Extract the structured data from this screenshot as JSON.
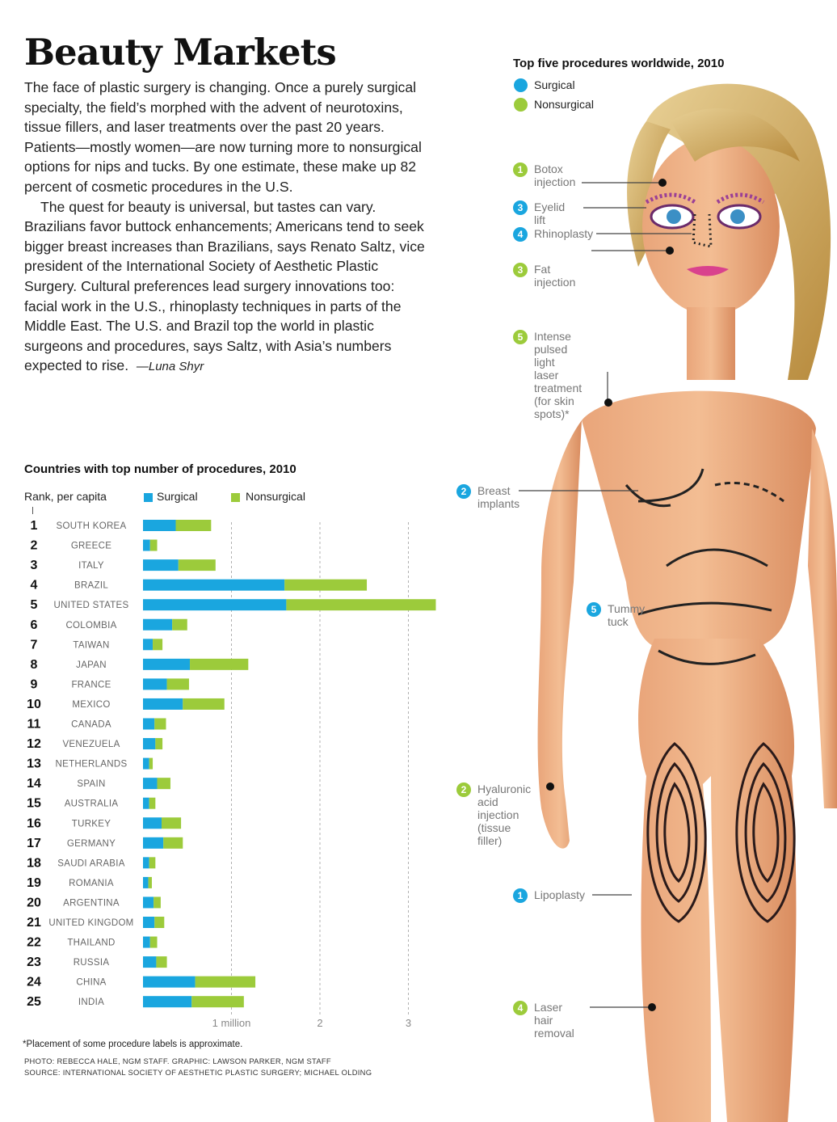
{
  "article": {
    "title": "Beauty Markets",
    "para1": "The face of plastic surgery is changing. Once a purely surgical specialty, the field’s morphed with the advent of neurotoxins, tissue fillers, and laser treatments over the past 20 years. Patients—mostly women—are now turning more to nonsurgical options for nips and tucks. By one estimate, these make up 82 percent of cosmetic procedures in the U.S.",
    "para2": "The quest for beauty is universal, but tastes can vary. Brazilians favor buttock enhancements; Americans tend to seek bigger breast increases than Brazilians, says Renato Saltz, vice president of the International Society of Aesthetic Plastic Surgery. Cultural preferences lead surgery innovations too: facial work in the U.S., rhinoplasty techniques in parts of the Middle East. The U.S. and Brazil top the world in plastic surgeons and procedures, says Saltz, with Asia’s numbers expected to rise.",
    "byline": "—Luna Shyr"
  },
  "colors": {
    "surgical": "#1aa6df",
    "nonsurgical": "#9ccb3b"
  },
  "chart_data": {
    "type": "bar",
    "orientation": "horizontal",
    "stacked": true,
    "title": "Countries with top number of procedures, 2010",
    "rank_label": "Rank, per capita",
    "categories": [
      "SOUTH KOREA",
      "GREECE",
      "ITALY",
      "BRAZIL",
      "UNITED STATES",
      "COLOMBIA",
      "TAIWAN",
      "JAPAN",
      "FRANCE",
      "MEXICO",
      "CANADA",
      "VENEZUELA",
      "NETHERLANDS",
      "SPAIN",
      "AUSTRALIA",
      "TURKEY",
      "GERMANY",
      "SAUDI ARABIA",
      "ROMANIA",
      "ARGENTINA",
      "UNITED KINGDOM",
      "THAILAND",
      "RUSSIA",
      "CHINA",
      "INDIA"
    ],
    "ranks": [
      "1",
      "2",
      "3",
      "4",
      "5",
      "6",
      "7",
      "8",
      "9",
      "10",
      "11",
      "12",
      "13",
      "14",
      "15",
      "16",
      "17",
      "18",
      "19",
      "20",
      "21",
      "22",
      "23",
      "24",
      "25"
    ],
    "series": [
      {
        "name": "Surgical",
        "values": [
          0.37,
          0.08,
          0.4,
          1.6,
          1.62,
          0.33,
          0.11,
          0.53,
          0.27,
          0.45,
          0.13,
          0.14,
          0.07,
          0.16,
          0.07,
          0.21,
          0.23,
          0.07,
          0.06,
          0.12,
          0.13,
          0.08,
          0.15,
          0.59,
          0.55
        ]
      },
      {
        "name": "Nonsurgical",
        "values": [
          0.4,
          0.08,
          0.42,
          0.93,
          1.69,
          0.17,
          0.11,
          0.66,
          0.25,
          0.47,
          0.13,
          0.08,
          0.04,
          0.15,
          0.07,
          0.22,
          0.22,
          0.07,
          0.04,
          0.08,
          0.11,
          0.08,
          0.12,
          0.68,
          0.59
        ]
      }
    ],
    "xticks": [
      "1 million",
      "2",
      "3"
    ],
    "xtick_values": [
      1,
      2,
      3
    ],
    "xlim": [
      0,
      3.4
    ],
    "grid": true,
    "legend_position": "top"
  },
  "procedures_panel": {
    "title": "Top five procedures worldwide, 2010",
    "legend": [
      {
        "label": "Surgical",
        "color": "#1aa6df"
      },
      {
        "label": "Nonsurgical",
        "color": "#9ccb3b"
      }
    ],
    "items": [
      {
        "rank": "1",
        "label": "Botox\ninjection",
        "type": "nonsurgical"
      },
      {
        "rank": "3",
        "label": "Eyelid lift",
        "type": "surgical"
      },
      {
        "rank": "4",
        "label": "Rhinoplasty",
        "type": "surgical"
      },
      {
        "rank": "3",
        "label": "Fat injection",
        "type": "nonsurgical"
      },
      {
        "rank": "5",
        "label": "Intense pulsed\nlight laser treatment\n(for skin spots)*",
        "type": "nonsurgical"
      },
      {
        "rank": "2",
        "label": "Breast\nimplants",
        "type": "surgical"
      },
      {
        "rank": "5",
        "label": "Tummy\ntuck",
        "type": "surgical"
      },
      {
        "rank": "2",
        "label": "Hyaluronic\nacid\ninjection\n(tissue filler)",
        "type": "nonsurgical"
      },
      {
        "rank": "1",
        "label": "Lipoplasty",
        "type": "surgical"
      },
      {
        "rank": "4",
        "label": "Laser hair\nremoval",
        "type": "nonsurgical"
      }
    ]
  },
  "footnote": "*Placement of some procedure labels is approximate.",
  "credits": [
    "PHOTO: REBECCA HALE, NGM STAFF. GRAPHIC: LAWSON PARKER, NGM STAFF",
    "SOURCE: INTERNATIONAL SOCIETY OF AESTHETIC PLASTIC SURGERY; MICHAEL OLDING"
  ]
}
